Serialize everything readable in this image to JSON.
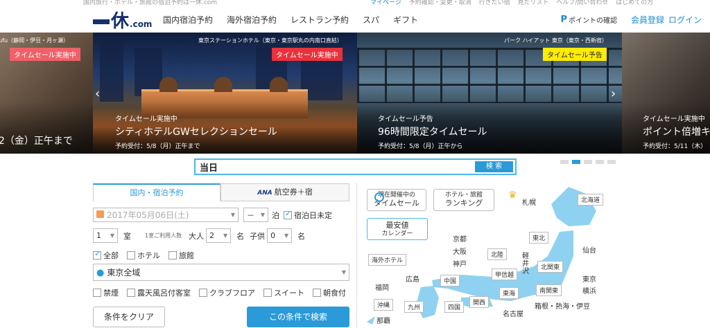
{
  "topbar": {
    "breadcrumb": "国内旅行・ホテル・旅館の宿泊予約は一休.com",
    "links": [
      "マイページ",
      "予約確認・変更・取消",
      "行きたい宿",
      "見たリスト",
      "ヘルプ/問い合わせ",
      "はじめての方"
    ]
  },
  "logo": {
    "kanji": "休",
    "suffix": ".com"
  },
  "nav": {
    "items": [
      "国内宿泊予約",
      "海外宿泊予約",
      "レストラン予約",
      "スパ",
      "ギフト"
    ]
  },
  "user": {
    "points_icon": "P",
    "points": "ポイントの確認",
    "register": "会員登録",
    "login": "ログイン"
  },
  "slides": [
    {
      "hotel": "Fufu（静岡・伊豆・月ヶ瀬）",
      "badge": "タイムセール実施中",
      "title": "2（金）正午まで"
    },
    {
      "hotel": "東京ステーションホテル（東京・東京駅丸の内南口直結）",
      "badge": "タイムセール実施中",
      "line1": "タイムセール実施中",
      "title": "シティホテルGWセレクションセール",
      "line3": "予約受付：5/8（月）正午まで"
    },
    {
      "hotel": "パーク ハイアット 東京（東京・西新宿）",
      "badge": "タイムセール予告",
      "line1": "タイムセール予告",
      "title": "96時間限定タイムセール",
      "line3": "予約受付：5/8（月）正午から"
    },
    {
      "line1": "タイムセール実施中",
      "title": "ポイント倍増キ",
      "line3": "予約受付：5/11（木）"
    }
  ],
  "colors": {
    "accent": "#2a9ad8",
    "badge_red": "#e8323c",
    "badge_yellow": "#ffec00",
    "brand": "#14306b"
  },
  "search": {
    "value": "当日",
    "button": "検 索"
  },
  "tabs": {
    "domestic": "国内・宿泊予約",
    "ana_logo": "ANA",
    "ana": "航空券＋宿"
  },
  "form": {
    "date": "2017年05月06日(土)",
    "nights_value": "－",
    "nights_unit": "泊",
    "undecided": "宿泊日未定",
    "rooms_value": "1",
    "rooms_unit": "室",
    "per_room": "1室ご利用人数",
    "adults_label": "大人",
    "adults_value": "2",
    "adults_unit": "名",
    "children_label": "子供",
    "children_value": "0",
    "children_unit": "名",
    "types": [
      "全部",
      "ホテル",
      "旅館"
    ],
    "area": "東京全域",
    "options": [
      "禁煙",
      "露天風呂付客室",
      "クラブフロア",
      "スイート",
      "朝食付"
    ],
    "clear": "条件をクリア",
    "submit": "この条件で検索"
  },
  "map": {
    "timesale_small": "現在開催中の",
    "timesale": "タイムセール",
    "ranking_small": "ホテル・旅館",
    "ranking": "ランキング",
    "cheapest": "最安値",
    "calendar": "カレンダー",
    "overseas": "海外ホテル",
    "cities": {
      "sapporo": "札幌",
      "kyoto": "京都",
      "osaka": "大阪",
      "kobe": "神戸",
      "karuizawa": "軽井沢",
      "sendai": "仙台",
      "tokyo": "東京",
      "yokohama": "横浜",
      "hiroshima": "広島",
      "fukuoka": "福岡",
      "naha": "那覇",
      "nagoya": "名古屋",
      "hakone": "箱根・熱海・伊豆"
    },
    "regions": {
      "hokkaido": "北海道",
      "tohoku": "東北",
      "hokuriku": "北陸",
      "kitakanto": "北関東",
      "koshinetsu": "甲信越",
      "chugoku": "中国",
      "shikoku": "四国",
      "kansai": "関西",
      "tokai": "東海",
      "minamikanto": "南関東",
      "kyushu": "九州",
      "okinawa": "沖縄"
    }
  }
}
